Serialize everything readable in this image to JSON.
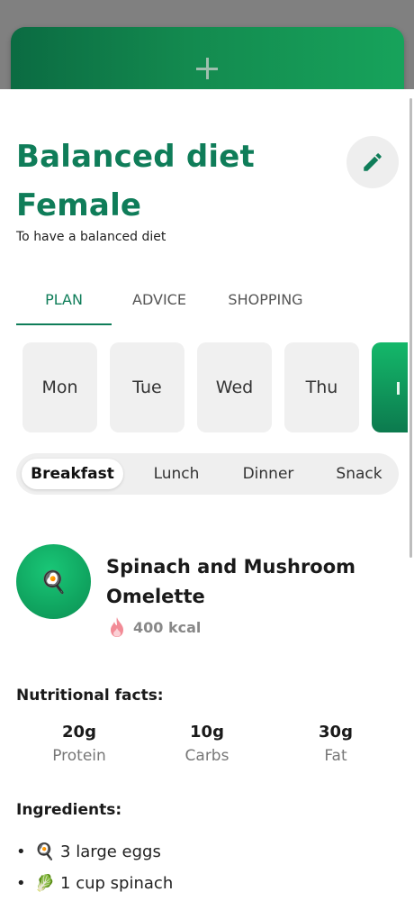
{
  "background_card": {
    "add_icon": "plus-icon"
  },
  "plan": {
    "title_line1": "Balanced diet",
    "title_line2": "Female",
    "subtitle": "To have a balanced diet",
    "edit_icon": "pencil-icon"
  },
  "tabs": [
    {
      "label": "PLAN",
      "active": true
    },
    {
      "label": "ADVICE",
      "active": false
    },
    {
      "label": "SHOPPING",
      "active": false
    }
  ],
  "days": [
    {
      "label": "Mon"
    },
    {
      "label": "Tue"
    },
    {
      "label": "Wed"
    },
    {
      "label": "Thu"
    }
  ],
  "meals": [
    {
      "label": "Breakfast",
      "active": true
    },
    {
      "label": "Lunch",
      "active": false
    },
    {
      "label": "Dinner",
      "active": false
    },
    {
      "label": "Snack",
      "active": false
    }
  ],
  "recipe": {
    "icon": "🍳",
    "name": "Spinach and Mushroom Omelette",
    "kcal": "400 kcal",
    "kcal_icon": "flame-icon"
  },
  "nutrition": {
    "title": "Nutritional facts:",
    "facts": [
      {
        "value": "20g",
        "label": "Protein"
      },
      {
        "value": "10g",
        "label": "Carbs"
      },
      {
        "value": "30g",
        "label": "Fat"
      }
    ]
  },
  "ingredients": {
    "title": "Ingredients:",
    "items": [
      {
        "emoji": "🍳",
        "text": "3 large eggs"
      },
      {
        "emoji": "🥬",
        "text": "1 cup spinach"
      }
    ]
  },
  "colors": {
    "accent": "#0f7d59",
    "gradient_start": "#19c777",
    "gradient_end": "#0d8f54"
  }
}
